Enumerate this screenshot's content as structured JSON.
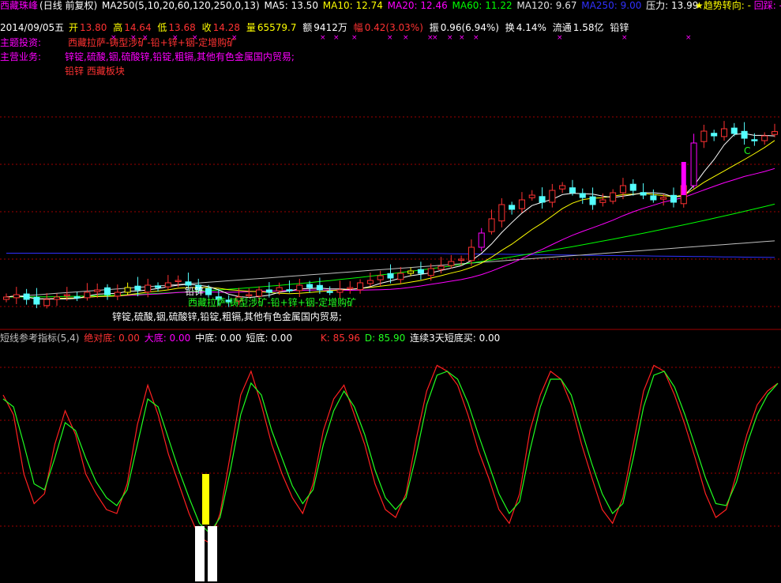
{
  "header": {
    "stock_name": "西藏珠峰",
    "period": "(日线 前复权)",
    "ma_params": "MA250(5,10,20,60,120,250,0,13)",
    "ma5": "MA5: 13.50",
    "ma10": "MA10: 12.74",
    "ma20": "MA20: 12.46",
    "ma60": "MA60: 11.22",
    "ma120": "MA120: 9.67",
    "ma250": "MA250: 9.00",
    "pressure": "压力: 13.99",
    "trend_star": "★趋势转向: -",
    "pullback": "回踩: -"
  },
  "quote": {
    "date": "2014/09/05五",
    "open_label": "开",
    "open": "13.80",
    "high_label": "高",
    "high": "14.64",
    "low_label": "低",
    "low": "13.68",
    "close_label": "收",
    "close": "14.28",
    "volume_label": "量",
    "volume": "65579.7",
    "amount_label": "额",
    "amount": "9412万",
    "change_label": "幅",
    "change": "0.42(3.03%)",
    "amplitude_label": "振",
    "amplitude": "0.96(6.94%)",
    "turnover_label": "换",
    "turnover": "4.14%",
    "float_label": "流通",
    "float_cap": "1.58亿",
    "sector": "铅锌"
  },
  "info": {
    "theme_label": "主题投资:",
    "theme_value": "西藏拉萨-铸型涉矿-铅+锌+铟-定增购矿",
    "business_label": "主营业务:",
    "business_value": "锌锭,硫酸,铟,硫酸锌,铅锭,粗镉,其他有色金属国内贸易;",
    "sector_value": "铅锌 西藏板块"
  },
  "annotations": {
    "sector_tag": "铅锌",
    "theme_tag": "西藏拉萨-铸型涉矿-铅+锌+铟-定增购矿",
    "business_tag": "锌锭,硫酸,铟,硫酸锌,铅锭,粗镉,其他有色金属国内贸易;",
    "c_marker": "C"
  },
  "indicator": {
    "name": "短线参考指标(5,4)",
    "abs_bottom": "绝对底: 0.00",
    "big_bottom": "大底: 0.00",
    "mid_bottom": "中底: 0.00",
    "short_bottom": "短底: 0.00",
    "k": "K: 85.96",
    "d": "D: 85.90",
    "consecutive": "连续3天短底买: 0.00"
  },
  "colors": {
    "up": "#ff3232",
    "down": "#54ffff",
    "flat": "#ffffff",
    "ma5": "#ffffff",
    "ma10": "#ffff00",
    "ma20": "#ff00ff",
    "ma60": "#00ff00",
    "ma120": "#c0c0c0",
    "ma250": "#3030ff",
    "k_line": "#ff2020",
    "d_line": "#20ff20",
    "grid": "#a00000"
  },
  "chart_data": [
    {
      "type": "candlestick",
      "title": "西藏珠峰 (日线 前复权)",
      "ylim": [
        6.0,
        16.5
      ],
      "overlays": [
        "MA5",
        "MA10",
        "MA20",
        "MA60",
        "MA120",
        "MA250"
      ],
      "last": {
        "open": 13.8,
        "high": 14.64,
        "low": 13.68,
        "close": 14.28
      },
      "close_series": [
        7.3,
        7.4,
        7.2,
        7.0,
        7.2,
        7.3,
        7.4,
        7.3,
        7.5,
        7.6,
        7.4,
        7.5,
        7.7,
        7.6,
        7.8,
        7.7,
        7.9,
        8.0,
        7.8,
        7.6,
        7.4,
        7.2,
        7.1,
        7.3,
        7.4,
        7.6,
        7.5,
        7.7,
        7.6,
        7.8,
        7.7,
        7.6,
        7.5,
        7.6,
        7.7,
        7.9,
        8.0,
        8.2,
        8.1,
        8.3,
        8.4,
        8.3,
        8.5,
        8.6,
        8.8,
        8.9,
        9.4,
        10.0,
        10.6,
        11.2,
        11.0,
        11.4,
        11.6,
        11.3,
        11.8,
        12.0,
        11.7,
        11.5,
        11.2,
        11.4,
        11.7,
        12.0,
        11.8,
        11.6,
        11.4,
        11.5,
        11.3,
        12.0,
        13.8,
        14.3,
        14.1,
        14.4,
        14.2,
        14.0,
        13.9,
        14.1,
        14.28
      ]
    },
    {
      "type": "line",
      "title": "短线参考指标(5,4)",
      "ylim": [
        0,
        100
      ],
      "series": [
        {
          "name": "K",
          "values": [
            80,
            70,
            40,
            25,
            30,
            55,
            72,
            60,
            40,
            30,
            22,
            20,
            35,
            65,
            85,
            70,
            50,
            35,
            20,
            8,
            5,
            20,
            50,
            80,
            92,
            75,
            55,
            40,
            28,
            20,
            35,
            62,
            78,
            85,
            70,
            55,
            35,
            22,
            18,
            30,
            58,
            82,
            95,
            92,
            85,
            70,
            52,
            38,
            22,
            15,
            30,
            62,
            80,
            92,
            88,
            75,
            55,
            38,
            22,
            15,
            28,
            55,
            82,
            95,
            92,
            80,
            65,
            48,
            30,
            18,
            22,
            40,
            60,
            75,
            82,
            85.96
          ]
        },
        {
          "name": "D",
          "values": [
            78,
            74,
            55,
            35,
            32,
            48,
            66,
            62,
            48,
            36,
            28,
            24,
            32,
            55,
            78,
            74,
            58,
            42,
            28,
            15,
            10,
            18,
            42,
            70,
            86,
            80,
            62,
            48,
            34,
            25,
            32,
            55,
            72,
            82,
            74,
            60,
            42,
            28,
            22,
            28,
            50,
            75,
            90,
            92,
            88,
            76,
            60,
            45,
            30,
            20,
            26,
            52,
            74,
            88,
            88,
            80,
            62,
            45,
            30,
            20,
            25,
            48,
            74,
            90,
            92,
            84,
            70,
            54,
            38,
            25,
            24,
            36,
            55,
            70,
            80,
            85.9
          ]
        }
      ]
    }
  ]
}
